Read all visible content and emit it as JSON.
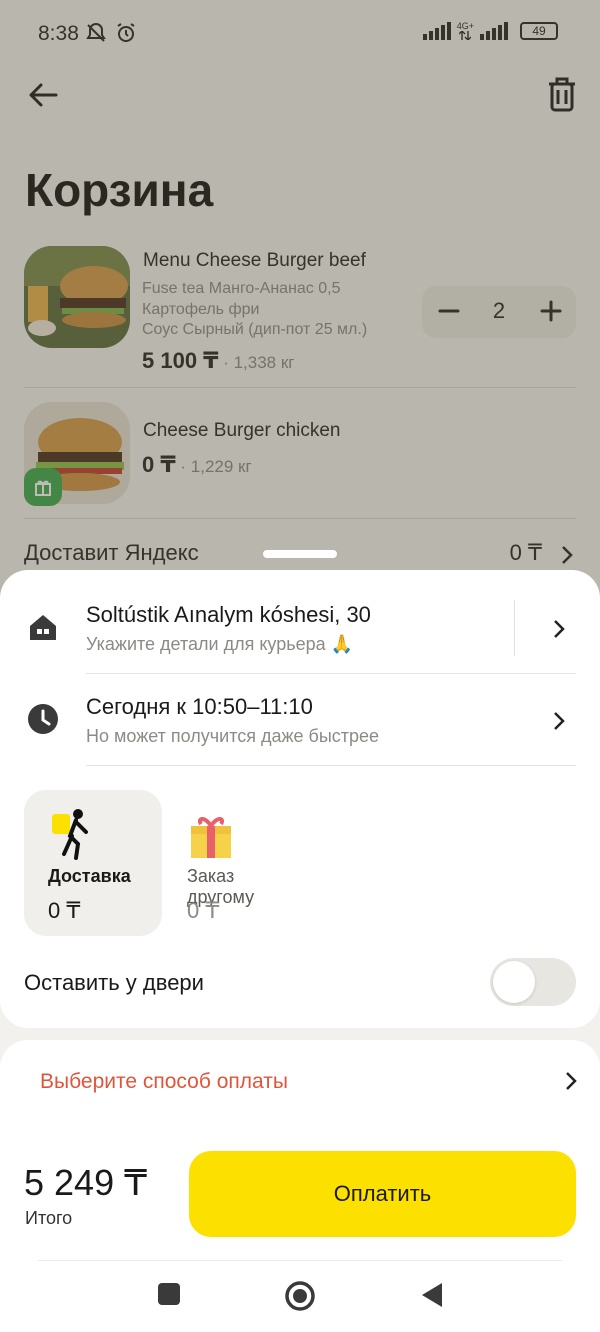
{
  "status_bar": {
    "time": "8:38",
    "network": "4G+",
    "battery": "49"
  },
  "page": {
    "title": "Корзина"
  },
  "cart": {
    "items": [
      {
        "name": "Menu Cheese Burger beef",
        "options": [
          "Fuse tea Манго-Ананас 0,5",
          "Картофель фри",
          "Соус Сырный (дип-пот 25 мл.)"
        ],
        "price": "5 100 ₸",
        "weight": " · 1,338 кг",
        "quantity": "2"
      },
      {
        "name": "Cheese Burger chicken",
        "price": "0 ₸",
        "weight": " · 1,229 кг"
      }
    ],
    "delivery": {
      "label": "Доставит Яндекс",
      "price": "0 ₸"
    }
  },
  "address": {
    "title": "Soltústik Aınalym kóshesi, 30",
    "subtitle": "Укажите детали для курьера 🙏"
  },
  "time_slot": {
    "title": "Сегодня к 10:50–11:10",
    "subtitle": "Но может получится даже быстрее"
  },
  "delivery_modes": [
    {
      "label": "Доставка",
      "price": "0 ₸",
      "selected": true
    },
    {
      "label": "Заказ другому",
      "price": "0 ₸",
      "selected": false
    }
  ],
  "leave_at_door": {
    "label": "Оставить у двери",
    "enabled": false
  },
  "payment": {
    "label": "Выберите способ оплаты"
  },
  "footer": {
    "total": "5 249 ₸",
    "total_label": "Итого",
    "pay_button": "Оплатить"
  },
  "colors": {
    "accent_yellow": "#fce000",
    "payment_warning": "#e0553a",
    "gift_green": "#3aa84b"
  }
}
